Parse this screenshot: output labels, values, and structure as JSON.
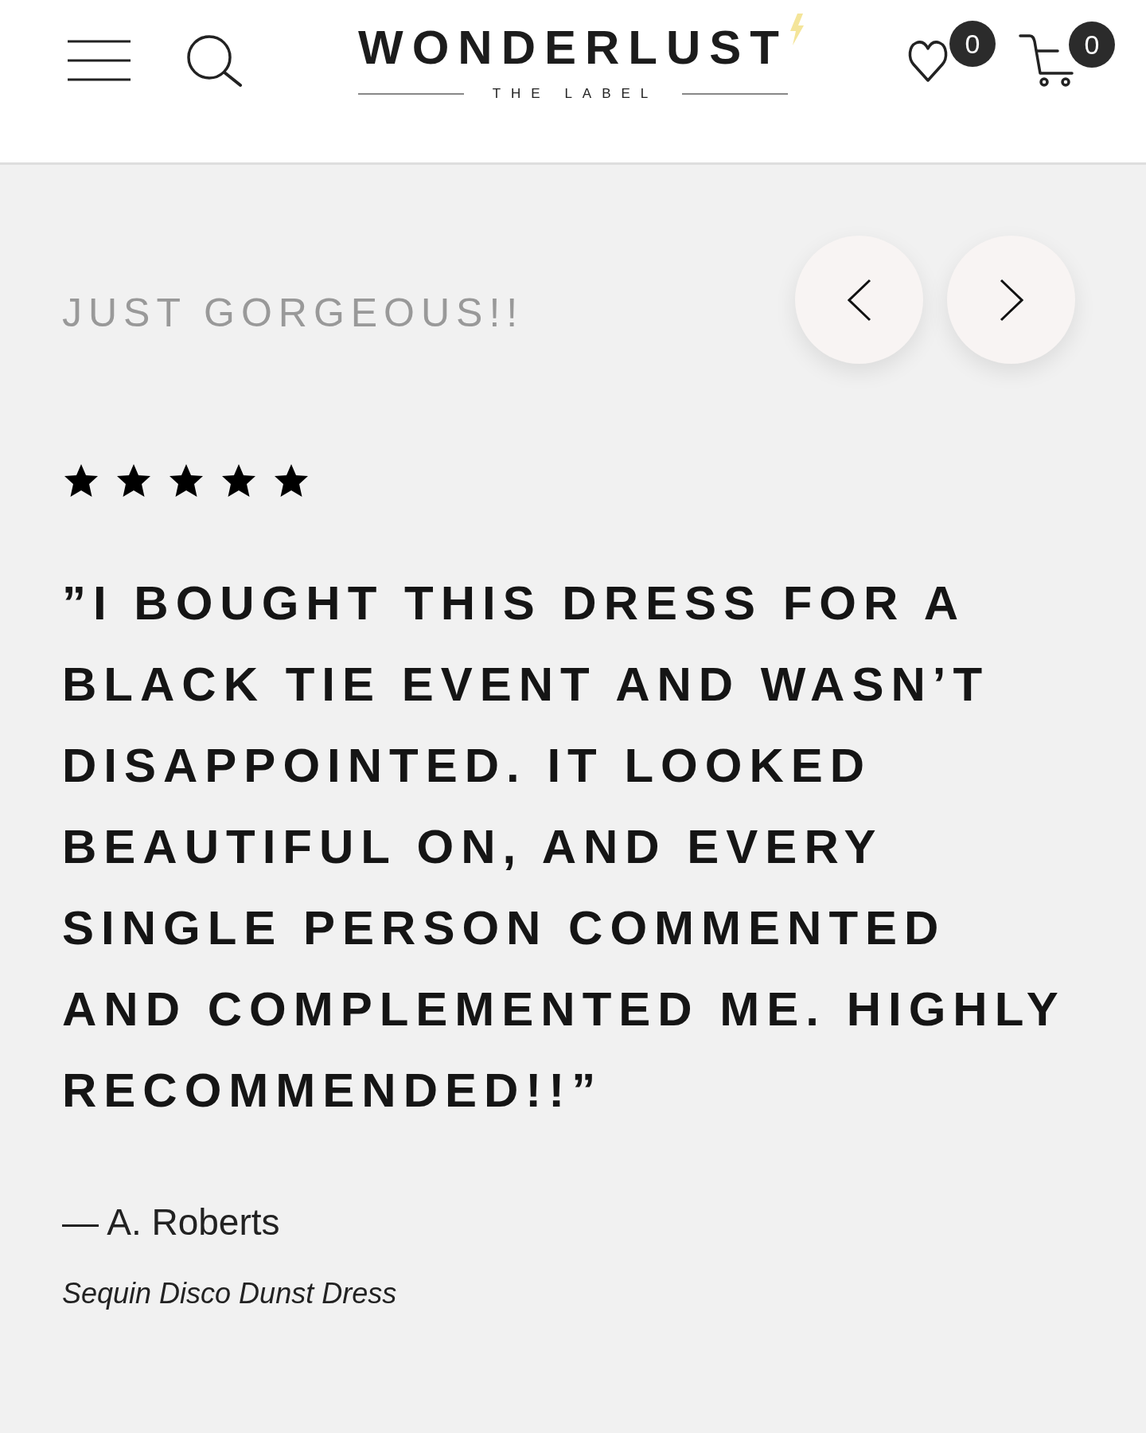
{
  "header": {
    "logo": {
      "wordmark": "WONDERLUST",
      "tagline": "THE LABEL"
    },
    "wishlist_count": "0",
    "cart_count": "0"
  },
  "review": {
    "title": "JUST GORGEOUS!!",
    "stars": 5,
    "quote": "”I BOUGHT THIS DRESS FOR A BLACK TIE EVENT AND WASN’T DISAPPOINTED. IT LOOKED BEAUTIFUL ON, AND EVERY SINGLE PERSON COMMENTED AND COMPLEMENTED ME. HIGHLY RECOMMENDED!!”",
    "author": "— A. Roberts",
    "product": "Sequin Disco Dunst Dress"
  }
}
